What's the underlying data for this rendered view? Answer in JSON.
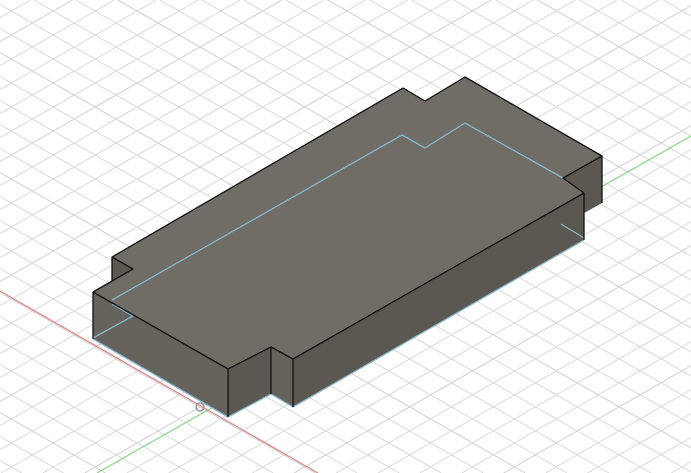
{
  "viewport": {
    "type": "3d-cad-canvas",
    "colors": {
      "background": "#ffffff",
      "grid": "#d9d9d9",
      "x_axis": "#e07070",
      "y_axis": "#6fcf6f",
      "top_face": "#706d66",
      "side_face": "#5b5852",
      "side_face_light": "#66635c",
      "edge": "#111111",
      "sketch_line": "#86b6cc"
    }
  }
}
